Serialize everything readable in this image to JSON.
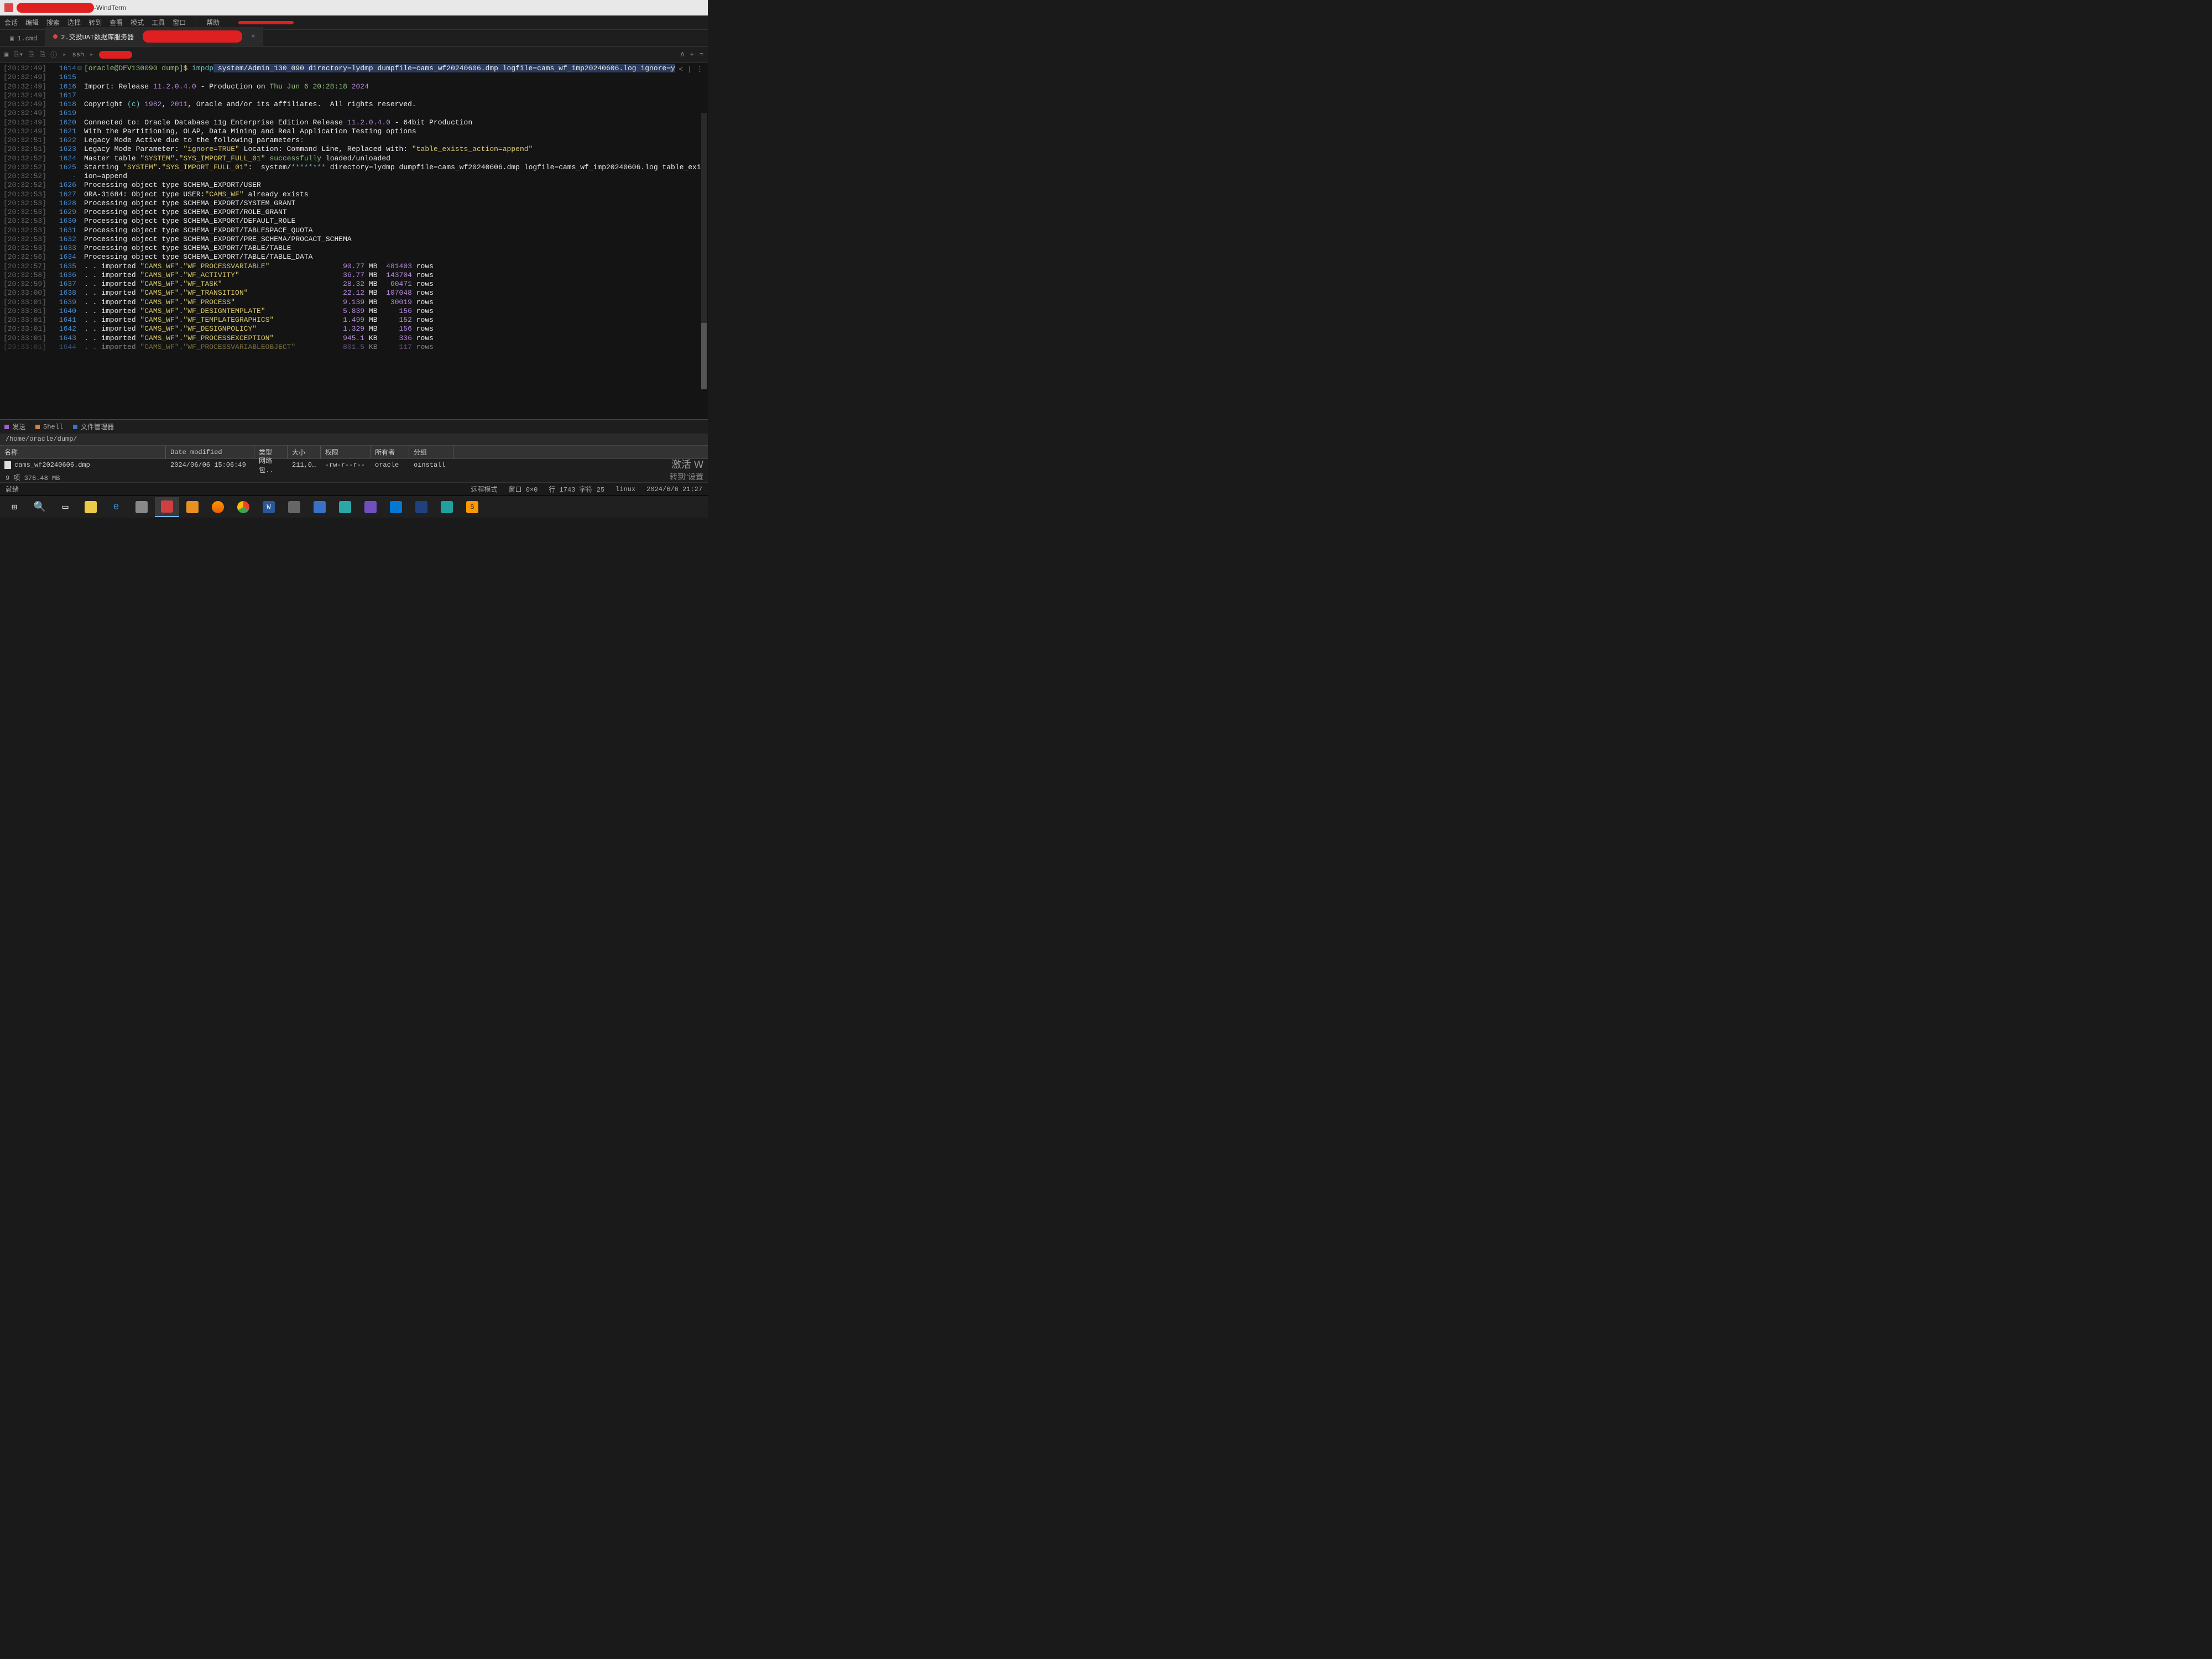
{
  "window": {
    "title": "WindTerm",
    "title_sep": " - "
  },
  "menu": {
    "session": "会话",
    "edit": "编辑",
    "search": "搜索",
    "select": "选择",
    "goto": "转到",
    "view": "查看",
    "mode": "模式",
    "tools": "工具",
    "window": "窗口",
    "help": "帮助"
  },
  "tabs": {
    "t1": "1.cmd",
    "t2": "2.交投UAT数据库服务器",
    "close": "×"
  },
  "toolbar": {
    "crumb1": "ssh",
    "right_a": "A",
    "right_plus": "+",
    "right_eq": "="
  },
  "term_icons": {
    "chev": "> <",
    "bar": "|",
    "dots": "⋮"
  },
  "gutter_fold": "⊟",
  "lines": [
    {
      "ts": "[20:32:49]",
      "ln": "1614",
      "fold": true,
      "segs": [
        {
          "t": "[oracle@DEV130090 dump]",
          "c": "c-green"
        },
        {
          "t": "$ ",
          "c": "c-yellow"
        },
        {
          "t": "impdp",
          "c": "c-cyan"
        },
        {
          "t": " system/Admin_130_090 directory=lydmp dumpfile=cams_wf20240606.dmp logfile=cams_wf_imp20240606.log ignore=y",
          "c": "c-white",
          "hl": true
        }
      ]
    },
    {
      "ts": "[20:32:49]",
      "ln": "1615",
      "segs": []
    },
    {
      "ts": "[20:32:49]",
      "ln": "1616",
      "segs": [
        {
          "t": "Import: Release ",
          "c": "c-white"
        },
        {
          "t": "11.2.0.4.0",
          "c": "c-purple"
        },
        {
          "t": " - Production on ",
          "c": "c-white"
        },
        {
          "t": "Thu Jun 6 20:28:18",
          "c": "c-green"
        },
        {
          "t": " 2024",
          "c": "c-purple"
        }
      ]
    },
    {
      "ts": "[20:32:49]",
      "ln": "1617",
      "segs": []
    },
    {
      "ts": "[20:32:49]",
      "ln": "1618",
      "segs": [
        {
          "t": "Copyright ",
          "c": "c-white"
        },
        {
          "t": "(c)",
          "c": "c-cyan"
        },
        {
          "t": " 1982",
          "c": "c-purple"
        },
        {
          "t": ", ",
          "c": "c-white"
        },
        {
          "t": "2011",
          "c": "c-purple"
        },
        {
          "t": ", Oracle and/or its affiliates.  All rights reserved.",
          "c": "c-white"
        }
      ]
    },
    {
      "ts": "[20:32:49]",
      "ln": "1619",
      "segs": []
    },
    {
      "ts": "[20:32:49]",
      "ln": "1620",
      "segs": [
        {
          "t": "Connected to",
          "c": "c-white"
        },
        {
          "t": ": ",
          "c": "c-cyan"
        },
        {
          "t": "Oracle Database 11g Enterprise Edition Release ",
          "c": "c-white"
        },
        {
          "t": "11.2.0.4.0",
          "c": "c-purple"
        },
        {
          "t": " - 64bit Production",
          "c": "c-white"
        }
      ]
    },
    {
      "ts": "[20:32:49]",
      "ln": "1621",
      "segs": [
        {
          "t": "With the Partitioning, OLAP, Data Mining and Real Application Testing options",
          "c": "c-white"
        }
      ]
    },
    {
      "ts": "[20:32:51]",
      "ln": "1622",
      "segs": [
        {
          "t": "Legacy Mode Active due to the following parameters",
          "c": "c-white"
        },
        {
          "t": ":",
          "c": "c-cyan"
        }
      ]
    },
    {
      "ts": "[20:32:51]",
      "ln": "1623",
      "segs": [
        {
          "t": "Legacy Mode Parameter: ",
          "c": "c-white"
        },
        {
          "t": "\"ignore=TRUE\"",
          "c": "c-yellow"
        },
        {
          "t": " Location: Command Line, Replaced with: ",
          "c": "c-white"
        },
        {
          "t": "\"table_exists_action=append\"",
          "c": "c-yellow"
        }
      ]
    },
    {
      "ts": "[20:32:52]",
      "ln": "1624",
      "segs": [
        {
          "t": "Master table ",
          "c": "c-white"
        },
        {
          "t": "\"SYSTEM\"",
          "c": "c-yellow"
        },
        {
          "t": ".",
          "c": "c-white"
        },
        {
          "t": "\"SYS_IMPORT_FULL_01\"",
          "c": "c-yellow"
        },
        {
          "t": " successfully",
          "c": "c-green"
        },
        {
          "t": " loaded/unloaded",
          "c": "c-white"
        }
      ]
    },
    {
      "ts": "[20:32:52]",
      "ln": "1625",
      "segs": [
        {
          "t": "Starting ",
          "c": "c-white"
        },
        {
          "t": "\"SYSTEM\"",
          "c": "c-yellow"
        },
        {
          "t": ".",
          "c": "c-white"
        },
        {
          "t": "\"SYS_IMPORT_FULL_01\"",
          "c": "c-yellow"
        },
        {
          "t": ":  system/",
          "c": "c-white"
        },
        {
          "t": "********",
          "c": "c-cyan"
        },
        {
          "t": " directory=lydmp dumpfile=cams_wf20240606.dmp logfile=cams_wf_imp20240606.log table_exists_act",
          "c": "c-white"
        },
        {
          "t": "↵",
          "c": "c-blue"
        }
      ]
    },
    {
      "ts": "[20:32:52]",
      "ln": "-",
      "segs": [
        {
          "t": "ion=append",
          "c": "c-white"
        }
      ]
    },
    {
      "ts": "[20:32:52]",
      "ln": "1626",
      "segs": [
        {
          "t": "Processing object type SCHEMA_EXPORT/USER",
          "c": "c-white"
        }
      ]
    },
    {
      "ts": "[20:32:53]",
      "ln": "1627",
      "segs": [
        {
          "t": "ORA-31684: Object type USER:",
          "c": "c-white"
        },
        {
          "t": "\"CAMS_WF\"",
          "c": "c-yellow"
        },
        {
          "t": " already exists",
          "c": "c-white"
        }
      ]
    },
    {
      "ts": "[20:32:53]",
      "ln": "1628",
      "segs": [
        {
          "t": "Processing object type SCHEMA_EXPORT/SYSTEM_GRANT",
          "c": "c-white"
        }
      ]
    },
    {
      "ts": "[20:32:53]",
      "ln": "1629",
      "segs": [
        {
          "t": "Processing object type SCHEMA_EXPORT/ROLE_GRANT",
          "c": "c-white"
        }
      ]
    },
    {
      "ts": "[20:32:53]",
      "ln": "1630",
      "segs": [
        {
          "t": "Processing object type SCHEMA_EXPORT/DEFAULT_ROLE",
          "c": "c-white"
        }
      ]
    },
    {
      "ts": "[20:32:53]",
      "ln": "1631",
      "segs": [
        {
          "t": "Processing object type SCHEMA_EXPORT/TABLESPACE_QUOTA",
          "c": "c-white"
        }
      ]
    },
    {
      "ts": "[20:32:53]",
      "ln": "1632",
      "segs": [
        {
          "t": "Processing object type SCHEMA_EXPORT/PRE_SCHEMA/PROCACT_SCHEMA",
          "c": "c-white"
        }
      ]
    },
    {
      "ts": "[20:32:53]",
      "ln": "1633",
      "segs": [
        {
          "t": "Processing object type SCHEMA_EXPORT/TABLE/TABLE",
          "c": "c-white"
        }
      ]
    },
    {
      "ts": "[20:32:56]",
      "ln": "1634",
      "segs": [
        {
          "t": "Processing object type SCHEMA_EXPORT/TABLE/TABLE_DATA",
          "c": "c-white"
        }
      ]
    },
    {
      "ts": "[20:32:57]",
      "ln": "1635",
      "imp": {
        "tbl": "\"CAMS_WF\".\"WF_PROCESSVARIABLE\"",
        "size": "90.77",
        "unit": "MB",
        "rows": "481403"
      }
    },
    {
      "ts": "[20:32:58]",
      "ln": "1636",
      "imp": {
        "tbl": "\"CAMS_WF\".\"WF_ACTIVITY\"",
        "size": "36.77",
        "unit": "MB",
        "rows": "143704"
      }
    },
    {
      "ts": "[20:32:59]",
      "ln": "1637",
      "imp": {
        "tbl": "\"CAMS_WF\".\"WF_TASK\"",
        "size": "28.32",
        "unit": "MB",
        "rows": "60471"
      }
    },
    {
      "ts": "[20:33:00]",
      "ln": "1638",
      "imp": {
        "tbl": "\"CAMS_WF\".\"WF_TRANSITION\"",
        "size": "22.12",
        "unit": "MB",
        "rows": "107048"
      }
    },
    {
      "ts": "[20:33:01]",
      "ln": "1639",
      "imp": {
        "tbl": "\"CAMS_WF\".\"WF_PROCESS\"",
        "size": "9.139",
        "unit": "MB",
        "rows": "30019"
      }
    },
    {
      "ts": "[20:33:01]",
      "ln": "1640",
      "imp": {
        "tbl": "\"CAMS_WF\".\"WF_DESIGNTEMPLATE\"",
        "size": "5.839",
        "unit": "MB",
        "rows": "156"
      }
    },
    {
      "ts": "[20:33:01]",
      "ln": "1641",
      "imp": {
        "tbl": "\"CAMS_WF\".\"WF_TEMPLATEGRAPHICS\"",
        "size": "1.499",
        "unit": "MB",
        "rows": "152"
      }
    },
    {
      "ts": "[20:33:01]",
      "ln": "1642",
      "imp": {
        "tbl": "\"CAMS_WF\".\"WF_DESIGNPOLICY\"",
        "size": "1.329",
        "unit": "MB",
        "rows": "156"
      }
    },
    {
      "ts": "[20:33:01]",
      "ln": "1643",
      "imp": {
        "tbl": "\"CAMS_WF\".\"WF_PROCESSEXCEPTION\"",
        "size": "945.1",
        "unit": "KB",
        "rows": "336"
      }
    },
    {
      "ts": "[20:33:01]",
      "ln": "1644",
      "imp": {
        "tbl": "\"CAMS_WF\".\"WF_PROCESSVARIABLEOBJECT\"",
        "size": "801.5",
        "unit": "KB",
        "rows": "117"
      },
      "cut": true
    }
  ],
  "imp_prefix": ". . imported ",
  "rows_label": " rows",
  "bottom_tabs": {
    "send": "发送",
    "shell": "Shell",
    "fm": "文件管理器"
  },
  "path": "/home/oracle/dump/",
  "file_headers": {
    "name": "名称",
    "date": "Date modified",
    "type": "类型",
    "size": "大小",
    "perm": "权限",
    "owner": "所有者",
    "group": "分组"
  },
  "file_row": {
    "name": "cams_wf20240606.dmp",
    "date": "2024/06/06 15:06:49",
    "type": "网络包..",
    "size": "211,0…",
    "perm": "-rw-r--r--",
    "owner": "oracle",
    "group": "oinstall"
  },
  "file_status": "9 项 376.48 MB",
  "activation": {
    "l1": "激活 W",
    "l2": "转到\"设置"
  },
  "status": {
    "ready": "就绪",
    "remote": "远程模式",
    "winsize": "窗口 0×0",
    "pos": "行 1743 字符 25",
    "os": "linux",
    "datetime": "2024/6/6 21:27"
  },
  "taskbar": {
    "start": "⊞"
  }
}
